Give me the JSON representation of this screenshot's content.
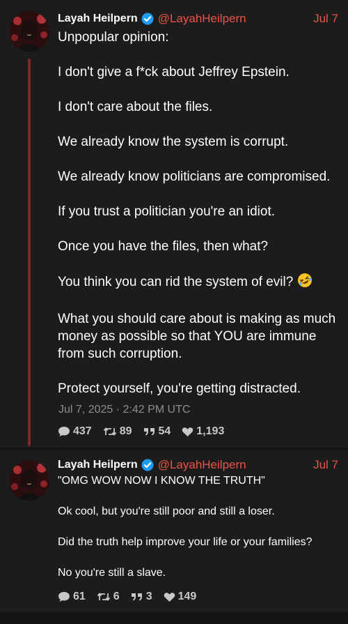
{
  "posts": [
    {
      "author": {
        "name": "Layah Heilpern",
        "handle": "@LayahHeilpern",
        "verified": true
      },
      "date": "Jul 7",
      "paragraphs": [
        "Unpopular opinion:",
        "I don't give a f*ck about Jeffrey Epstein.",
        "I don't care about the files.",
        "We already know the system is corrupt.",
        "We already know politicians are compromised.",
        "If you trust a politician you're an idiot.",
        "Once you have the files, then what?",
        "You think you can rid the system of evil?",
        "What you should care about is making as much money as possible so that YOU are immune from such corruption.",
        "Protect yourself, you're getting distracted."
      ],
      "emoji_after_paragraph_8": "rolling-on-floor-laughing",
      "timestamp": "Jul 7, 2025 · 2:42 PM UTC",
      "stats": {
        "replies": "437",
        "retweets": "89",
        "quotes": "54",
        "likes": "1,193"
      }
    },
    {
      "author": {
        "name": "Layah Heilpern",
        "handle": "@LayahHeilpern",
        "verified": true
      },
      "date": "Jul 7",
      "paragraphs": [
        "\"OMG WOW NOW I KNOW THE TRUTH\"",
        "Ok cool, but you're still poor and still a loser.",
        "Did the truth help improve your life or your families?",
        "No you're still a slave."
      ],
      "stats": {
        "replies": "61",
        "retweets": "6",
        "quotes": "3",
        "likes": "149"
      }
    }
  ],
  "colors": {
    "background": "#141414",
    "card": "#1c1c1c",
    "accent": "#e8564a",
    "verified": "#1d9bf0",
    "thread_line": "#7a2a2a",
    "muted": "#8e8e8e"
  },
  "icons": {
    "reply": "speech-bubble-icon",
    "retweet": "retweet-arrows-icon",
    "quote": "quote-marks-icon",
    "like": "heart-icon",
    "verified": "verified-badge-icon"
  }
}
